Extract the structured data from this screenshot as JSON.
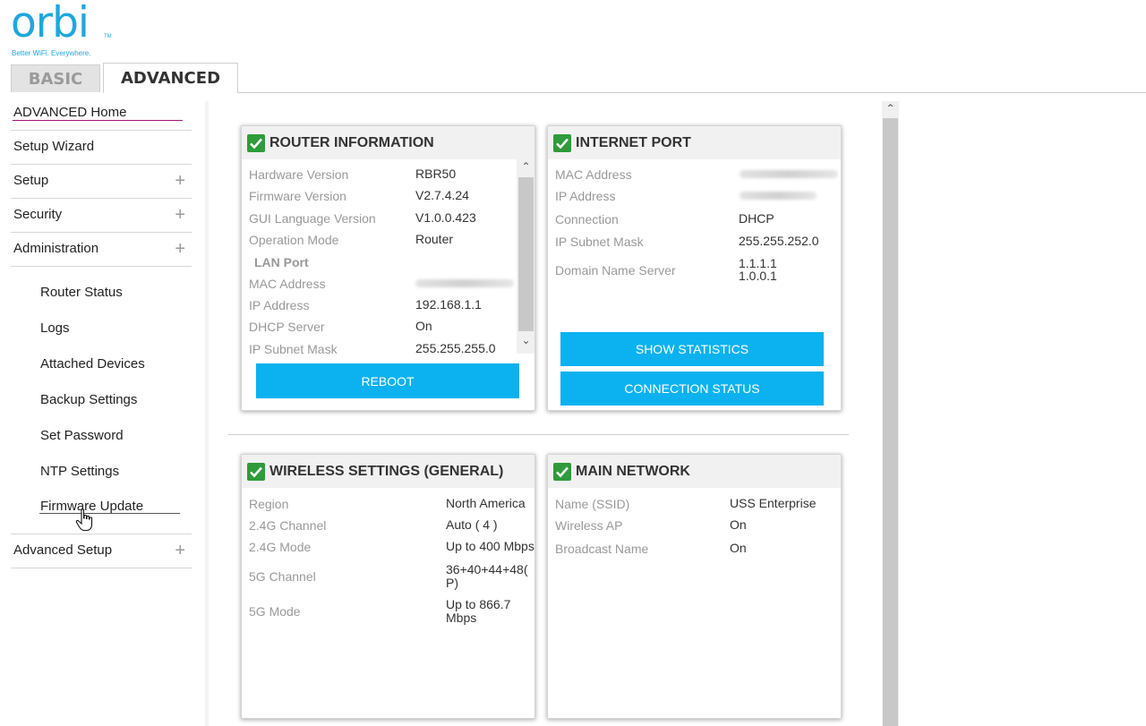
{
  "logo": {
    "word": "orbi",
    "tm": "TM",
    "tagline": "Better WiFi. Everywhere."
  },
  "tabs": {
    "basic": "BASIC",
    "advanced": "ADVANCED"
  },
  "sidebar": {
    "items": [
      {
        "label": "ADVANCED Home"
      },
      {
        "label": "Setup Wizard"
      },
      {
        "label": "Setup",
        "expander": "+"
      },
      {
        "label": "Security",
        "expander": "+"
      },
      {
        "label": "Administration",
        "expander": "+"
      }
    ],
    "sub_items": [
      "Router Status",
      "Logs",
      "Attached Devices",
      "Backup Settings",
      "Set Password",
      "NTP Settings",
      "Firmware Update"
    ],
    "advanced_setup": {
      "label": "Advanced Setup",
      "expander": "+"
    }
  },
  "router_info": {
    "title": "ROUTER INFORMATION",
    "rows": [
      {
        "label": "Hardware Version",
        "value": "RBR50"
      },
      {
        "label": "Firmware Version",
        "value": "V2.7.4.24"
      },
      {
        "label": "GUI Language Version",
        "value": "V1.0.0.423"
      },
      {
        "label": "Operation Mode",
        "value": "Router"
      },
      {
        "label": "LAN Port",
        "value": ""
      },
      {
        "label": "MAC Address",
        "value": ""
      },
      {
        "label": "IP Address",
        "value": "192.168.1.1"
      },
      {
        "label": "DHCP Server",
        "value": "On"
      },
      {
        "label": "IP Subnet Mask",
        "value": "255.255.255.0"
      }
    ],
    "reboot": "REBOOT"
  },
  "internet_port": {
    "title": "INTERNET PORT",
    "rows": [
      {
        "label": "MAC Address",
        "value": ""
      },
      {
        "label": "IP Address",
        "value": ""
      },
      {
        "label": "Connection",
        "value": "DHCP"
      },
      {
        "label": "IP Subnet Mask",
        "value": "255.255.252.0"
      },
      {
        "label": "Domain Name Server",
        "value": "1.1.1.1",
        "value2": "1.0.0.1"
      }
    ],
    "show_statistics": "SHOW STATISTICS",
    "connection_status": "CONNECTION STATUS"
  },
  "wireless": {
    "title": "WIRELESS SETTINGS (GENERAL)",
    "rows": [
      {
        "label": "Region",
        "value": "North America"
      },
      {
        "label": "2.4G Channel",
        "value": "Auto ( 4 )"
      },
      {
        "label": "2.4G Mode",
        "value": "Up to 400 Mbps"
      },
      {
        "label": "5G Channel",
        "value": "36+40+44+48(",
        "value2": "P)"
      },
      {
        "label": "5G Mode",
        "value": "Up to 866.7",
        "value2": "Mbps"
      }
    ]
  },
  "main_network": {
    "title": "MAIN NETWORK",
    "rows": [
      {
        "label": "Name (SSID)",
        "value": "USS Enterprise"
      },
      {
        "label": "Wireless AP",
        "value": "On"
      },
      {
        "label": "Broadcast Name",
        "value": "On"
      }
    ]
  },
  "icons": {
    "check": "check-icon",
    "cursor": "hand-pointer-icon",
    "scroll_up": "scroll-up-arrow-icon",
    "scroll_down": "scroll-down-arrow-icon"
  },
  "colors": {
    "brand": "#1ea7dd",
    "button": "#0bb2ef",
    "check": "#2f9b3a",
    "home_underline": "#a6137a"
  },
  "arrows": {
    "up": "⌃",
    "down": "⌄"
  }
}
